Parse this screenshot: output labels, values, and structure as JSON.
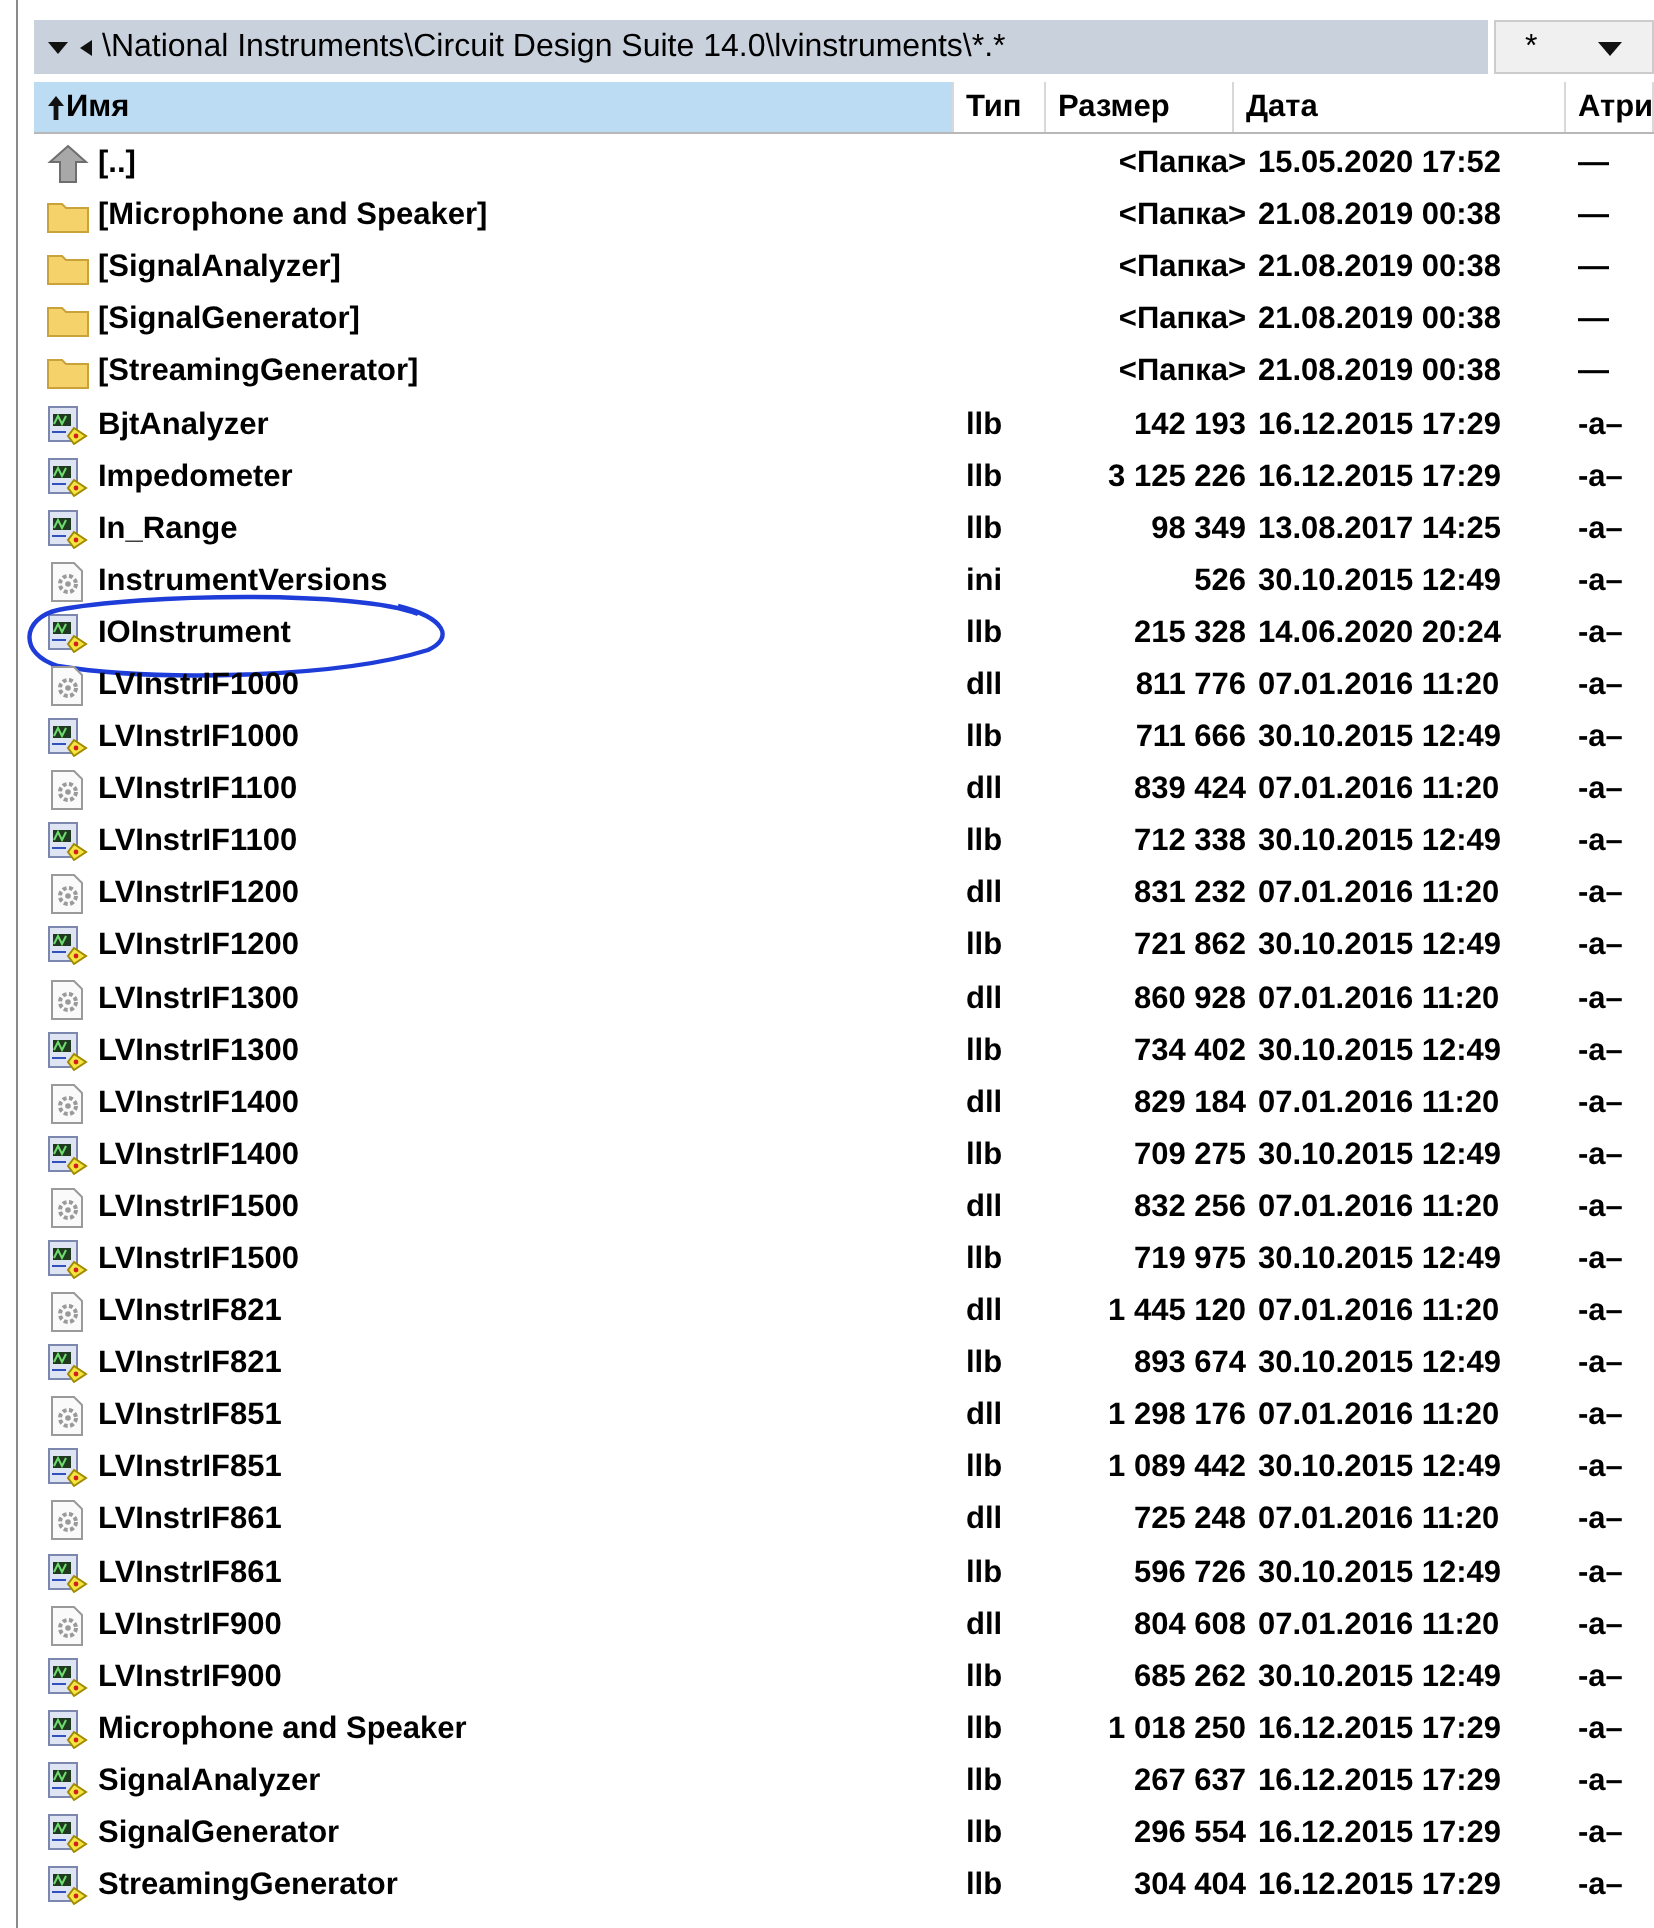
{
  "path_bar": {
    "path": "\\National Instruments\\Circuit Design Suite 14.0\\lvinstruments\\*.*",
    "filter": "*"
  },
  "columns": [
    {
      "label": "Имя",
      "selected": true
    },
    {
      "label": "Тип",
      "selected": false
    },
    {
      "label": "Размер",
      "selected": false
    },
    {
      "label": "Дата",
      "selected": false
    },
    {
      "label": "Атри",
      "selected": false
    }
  ],
  "rows": [
    {
      "kind": "up",
      "name": "[..]",
      "type": "",
      "size": "<Папка>",
      "date": "15.05.2020 17:52",
      "attr": "—",
      "circled": false
    },
    {
      "kind": "folder",
      "name": "[Microphone and Speaker]",
      "size": "<Папка>",
      "date": "21.08.2019 00:38",
      "attr": "—",
      "circled": false
    },
    {
      "kind": "folder",
      "name": "[SignalAnalyzer]",
      "size": "<Папка>",
      "date": "21.08.2019 00:38",
      "attr": "—",
      "circled": false
    },
    {
      "kind": "folder",
      "name": "[SignalGenerator]",
      "size": "<Папка>",
      "date": "21.08.2019 00:38",
      "attr": "—",
      "circled": false
    },
    {
      "kind": "folder",
      "name": "[StreamingGenerator]",
      "size": "<Папка>",
      "date": "21.08.2019 00:38",
      "attr": "—",
      "circled": false
    },
    {
      "kind": "library",
      "name": "BjtAnalyzer",
      "type": "llb",
      "size": "142 193",
      "date": "16.12.2015 17:29",
      "attr": "-a–",
      "circled": false
    },
    {
      "kind": "library",
      "name": "Impedometer",
      "type": "llb",
      "size": "3 125 226",
      "date": "16.12.2015 17:29",
      "attr": "-a–",
      "circled": false
    },
    {
      "kind": "library",
      "name": "In_Range",
      "type": "llb",
      "size": "98 349",
      "date": "13.08.2017 14:25",
      "attr": "-a–",
      "circled": false
    },
    {
      "kind": "settings",
      "name": "InstrumentVersions",
      "type": "ini",
      "size": "526",
      "date": "30.10.2015 12:49",
      "attr": "-a–",
      "circled": false
    },
    {
      "kind": "library",
      "name": "IOInstrument",
      "type": "llb",
      "size": "215 328",
      "date": "14.06.2020 20:24",
      "attr": "-a–",
      "circled": true
    },
    {
      "kind": "settings",
      "name": "LVInstrIF1000",
      "type": "dll",
      "size": "811 776",
      "date": "07.01.2016 11:20",
      "attr": "-a–",
      "circled": false
    },
    {
      "kind": "library",
      "name": "LVInstrIF1000",
      "type": "llb",
      "size": "711 666",
      "date": "30.10.2015 12:49",
      "attr": "-a–",
      "circled": false
    },
    {
      "kind": "settings",
      "name": "LVInstrIF1100",
      "type": "dll",
      "size": "839 424",
      "date": "07.01.2016 11:20",
      "attr": "-a–",
      "circled": false
    },
    {
      "kind": "library",
      "name": "LVInstrIF1100",
      "type": "llb",
      "size": "712 338",
      "date": "30.10.2015 12:49",
      "attr": "-a–",
      "circled": false
    },
    {
      "kind": "settings",
      "name": "LVInstrIF1200",
      "type": "dll",
      "size": "831 232",
      "date": "07.01.2016 11:20",
      "attr": "-a–",
      "circled": false
    },
    {
      "kind": "library",
      "name": "LVInstrIF1200",
      "type": "llb",
      "size": "721 862",
      "date": "30.10.2015 12:49",
      "attr": "-a–",
      "circled": false
    },
    {
      "kind": "settings",
      "name": "LVInstrIF1300",
      "type": "dll",
      "size": "860 928",
      "date": "07.01.2016 11:20",
      "attr": "-a–",
      "circled": false
    },
    {
      "kind": "library",
      "name": "LVInstrIF1300",
      "type": "llb",
      "size": "734 402",
      "date": "30.10.2015 12:49",
      "attr": "-a–",
      "circled": false
    },
    {
      "kind": "settings",
      "name": "LVInstrIF1400",
      "type": "dll",
      "size": "829 184",
      "date": "07.01.2016 11:20",
      "attr": "-a–",
      "circled": false
    },
    {
      "kind": "library",
      "name": "LVInstrIF1400",
      "type": "llb",
      "size": "709 275",
      "date": "30.10.2015 12:49",
      "attr": "-a–",
      "circled": false
    },
    {
      "kind": "settings",
      "name": "LVInstrIF1500",
      "type": "dll",
      "size": "832 256",
      "date": "07.01.2016 11:20",
      "attr": "-a–",
      "circled": false
    },
    {
      "kind": "library",
      "name": "LVInstrIF1500",
      "type": "llb",
      "size": "719 975",
      "date": "30.10.2015 12:49",
      "attr": "-a–",
      "circled": false
    },
    {
      "kind": "settings",
      "name": "LVInstrIF821",
      "type": "dll",
      "size": "1 445 120",
      "date": "07.01.2016 11:20",
      "attr": "-a–",
      "circled": false
    },
    {
      "kind": "library",
      "name": "LVInstrIF821",
      "type": "llb",
      "size": "893 674",
      "date": "30.10.2015 12:49",
      "attr": "-a–",
      "circled": false
    },
    {
      "kind": "settings",
      "name": "LVInstrIF851",
      "type": "dll",
      "size": "1 298 176",
      "date": "07.01.2016 11:20",
      "attr": "-a–",
      "circled": false
    },
    {
      "kind": "library",
      "name": "LVInstrIF851",
      "type": "llb",
      "size": "1 089 442",
      "date": "30.10.2015 12:49",
      "attr": "-a–",
      "circled": false
    },
    {
      "kind": "settings",
      "name": "LVInstrIF861",
      "type": "dll",
      "size": "725 248",
      "date": "07.01.2016 11:20",
      "attr": "-a–",
      "circled": false
    },
    {
      "kind": "library",
      "name": "LVInstrIF861",
      "type": "llb",
      "size": "596 726",
      "date": "30.10.2015 12:49",
      "attr": "-a–",
      "circled": false
    },
    {
      "kind": "settings",
      "name": "LVInstrIF900",
      "type": "dll",
      "size": "804 608",
      "date": "07.01.2016 11:20",
      "attr": "-a–",
      "circled": false
    },
    {
      "kind": "library",
      "name": "LVInstrIF900",
      "type": "llb",
      "size": "685 262",
      "date": "30.10.2015 12:49",
      "attr": "-a–",
      "circled": false
    },
    {
      "kind": "library",
      "name": "Microphone and Speaker",
      "type": "llb",
      "size": "1 018 250",
      "date": "16.12.2015 17:29",
      "attr": "-a–",
      "circled": false
    },
    {
      "kind": "library",
      "name": "SignalAnalyzer",
      "type": "llb",
      "size": "267 637",
      "date": "16.12.2015 17:29",
      "attr": "-a–",
      "circled": false
    },
    {
      "kind": "library",
      "name": "SignalGenerator",
      "type": "llb",
      "size": "296 554",
      "date": "16.12.2015 17:29",
      "attr": "-a–",
      "circled": false
    },
    {
      "kind": "library",
      "name": "StreamingGenerator",
      "type": "llb",
      "size": "304 404",
      "date": "16.12.2015 17:29",
      "attr": "-a–",
      "circled": false
    }
  ]
}
